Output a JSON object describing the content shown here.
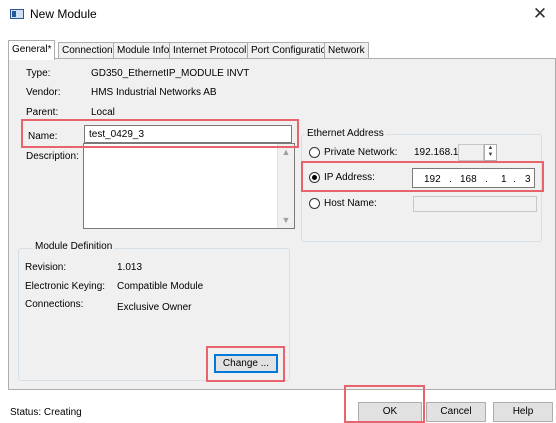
{
  "window": {
    "title": "New Module",
    "close_glyph": "✕"
  },
  "tabs": [
    {
      "label": "General*"
    },
    {
      "label": "Connection"
    },
    {
      "label": "Module Info"
    },
    {
      "label": "Internet Protocol"
    },
    {
      "label": "Port Configuration"
    },
    {
      "label": "Network"
    }
  ],
  "general": {
    "type_label": "Type:",
    "type_value": "GD350_EthernetIP_MODULE INVT",
    "vendor_label": "Vendor:",
    "vendor_value": "HMS Industrial Networks AB",
    "parent_label": "Parent:",
    "parent_value": "Local",
    "name_label": "Name:",
    "name_value": "test_0429_3",
    "description_label": "Description:",
    "description_value": ""
  },
  "module_definition": {
    "title": "Module Definition",
    "revision_label": "Revision:",
    "revision_value": "1.013",
    "keying_label": "Electronic Keying:",
    "keying_value": "Compatible Module",
    "connections_label": "Connections:",
    "connections_value": "Exclusive Owner",
    "change_button": "Change ..."
  },
  "ethernet": {
    "title": "Ethernet Address",
    "private_label": "Private Network:",
    "private_prefix": "192.168.1.",
    "private_suffix": "",
    "ip_label": "IP Address:",
    "ip": [
      "192",
      "168",
      "1",
      "3"
    ],
    "host_label": "Host Name:",
    "host_value": "",
    "selected": "ip"
  },
  "footer": {
    "status": "Status: Creating",
    "ok": "OK",
    "cancel": "Cancel",
    "help": "Help"
  },
  "colors": {
    "annotation_red": "#e8636b",
    "focus_blue": "#0078d7"
  }
}
